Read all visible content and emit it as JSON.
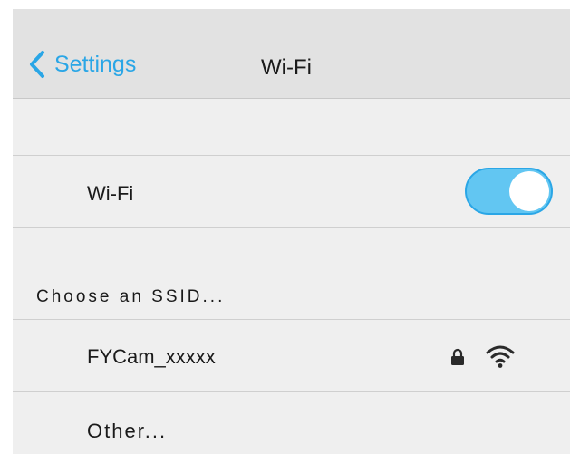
{
  "navbar": {
    "back_label": "Settings",
    "title": "Wi-Fi"
  },
  "wifi_toggle_row": {
    "label": "Wi-Fi",
    "enabled": true
  },
  "networks_section": {
    "header": "Choose an SSID...",
    "networks": [
      {
        "name": "FYCam_xxxxx",
        "secured": true,
        "icons": [
          "lock-icon",
          "wifi-signal-icon"
        ]
      }
    ],
    "other_label": "Other..."
  },
  "colors": {
    "accent": "#2aa6e6",
    "toggle_fill": "#62c6f2",
    "navbar_bg": "#e2e2e2",
    "list_bg": "#efefef",
    "separator": "#cfcfcf"
  }
}
